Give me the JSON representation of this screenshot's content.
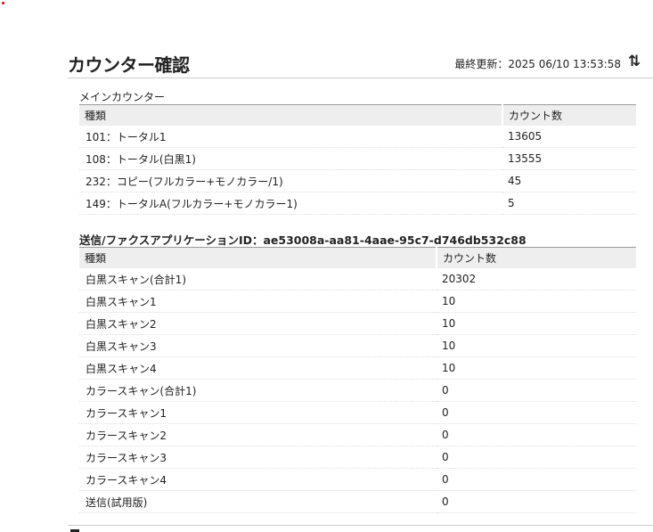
{
  "header": {
    "title": "カウンター確認",
    "last_updated_label": "最終更新：2025 06/10 13:53:58",
    "refresh_icon": "refresh-icon"
  },
  "main_counter": {
    "label": "メインカウンター",
    "columns": [
      "種類",
      "カウント数"
    ],
    "rows": [
      [
        "101：トータル1",
        "13605"
      ],
      [
        "108：トータル(白黒1)",
        "13555"
      ],
      [
        "232：コピー(フルカラー+モノカラー/1)",
        "45"
      ],
      [
        "149：トータルA(フルカラー+モノカラー1)",
        "5"
      ]
    ]
  },
  "send_fax": {
    "label": "送信/ファクスアプリケーションID：ae53008a-aa81-4aae-95c7-d746db532c88",
    "columns": [
      "種類",
      "カウント数"
    ],
    "rows": [
      [
        "白黒スキャン(合計1)",
        "20302"
      ],
      [
        "白黒スキャン1",
        "10"
      ],
      [
        "白黒スキャン2",
        "10"
      ],
      [
        "白黒スキャン3",
        "10"
      ],
      [
        "白黒スキャン4",
        "10"
      ],
      [
        "カラースキャン(合計1)",
        "0"
      ],
      [
        "カラースキャン1",
        "0"
      ],
      [
        "カラースキャン2",
        "0"
      ],
      [
        "カラースキャン3",
        "0"
      ],
      [
        "カラースキャン4",
        "0"
      ],
      [
        "送信(試用版)",
        "0"
      ]
    ]
  }
}
